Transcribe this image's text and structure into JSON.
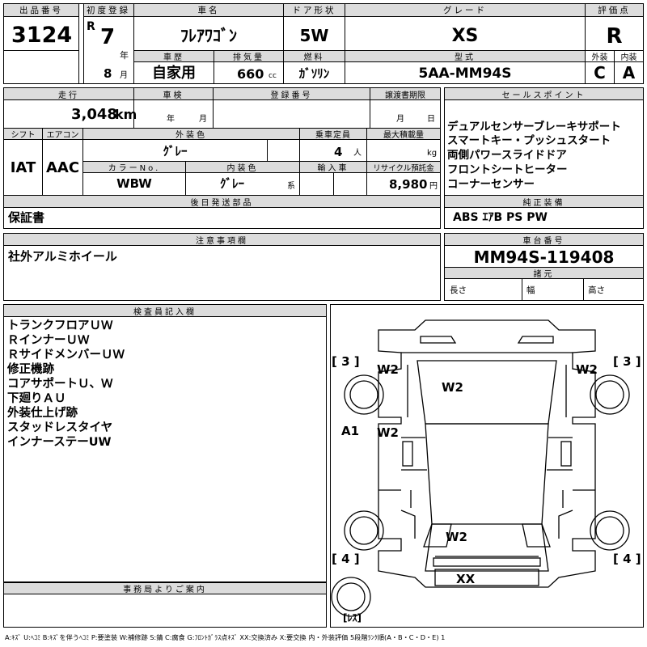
{
  "top": {
    "lot_no_label": "出品番号",
    "lot_no": "3124",
    "first_reg_label": "初度登録",
    "era": "R",
    "year": "7",
    "year_unit": "年",
    "month": "8",
    "month_unit": "月",
    "name_label": "車名",
    "name": "ﾌﾚｱﾜｺﾞﾝ",
    "door_label": "ドア形状",
    "door": "5W",
    "grade_label": "グレード",
    "grade": "XS",
    "score_label": "評価点",
    "score": "R",
    "history_label": "車歴",
    "history": "自家用",
    "cc_label": "排気量",
    "cc": "660",
    "cc_unit": "cc",
    "fuel_label": "燃料",
    "fuel": "ｶﾞｿﾘﾝ",
    "model_label": "型式",
    "model": "5AA-MM94S",
    "ext_label": "外装",
    "ext": "C",
    "int_label": "内装",
    "int": "A"
  },
  "mid": {
    "mileage_label": "走行",
    "mileage": "3,048",
    "mileage_unit": "km",
    "inspect_label": "車検",
    "inspect_year": "年",
    "inspect_month": "月",
    "reg_label": "登録番号",
    "transfer_label": "譲渡書期限",
    "transfer_month": "月",
    "transfer_day": "日",
    "shift_label": "シフト",
    "shift": "IAT",
    "ac_label": "エアコン",
    "ac": "AAC",
    "color_label": "外装色",
    "color": "ｸﾞﾚｰ",
    "cap_label": "乗車定員",
    "cap": "4",
    "cap_unit": "人",
    "load_label": "最大積載量",
    "load_unit": "kg",
    "color_no_label": "カラーNo.",
    "color_no": "WBW",
    "int_color_label": "内装色",
    "int_color": "ｸﾞﾚｰ",
    "int_color_unit": "系",
    "import_label": "輸入車",
    "recycle_label": "リサイクル預託金",
    "recycle": "8,980",
    "recycle_unit": "円",
    "later_label": "後日発送部品",
    "later": "保証書",
    "sales_label": "セールスポイント",
    "sales": [
      "デュアルセンサーブレーキサポート",
      "スマートキー・プッシュスタート",
      "両側パワースライドドア",
      "フロントシートヒーター",
      "コーナーセンサー"
    ],
    "equip_label": "純正装備",
    "equip": "ABS ｴｱB PS PW"
  },
  "notes": {
    "caution_label": "注意事項欄",
    "caution": "社外アルミホイール",
    "chassis_label": "車台番号",
    "chassis": "MM94S-119408",
    "spec_label": "諸元",
    "len": "長さ",
    "wid": "幅",
    "hei": "高さ"
  },
  "inspector": {
    "label": "検査員記入欄",
    "lines": [
      "トランクフロアＵＷ",
      "ＲインナーＵＷ",
      "ＲサイドメンバーＵＷ",
      "修正機跡",
      "コアサポートＵ、Ｗ",
      "下廻りＡＵ",
      "外装仕上げ跡",
      "スタッドレスタイヤ",
      "インナーステーUW"
    ]
  },
  "office": {
    "label": "事務局よりご案内"
  },
  "diagram": {
    "tl": "[ 3 ]",
    "tr": "[ 3 ]",
    "bl": "[ 4 ]",
    "br": "[ 4 ]",
    "w2_lf": "W2",
    "w2_hood": "W2",
    "w2_rf": "W2",
    "w2_door": "W2",
    "w2_trunk": "W2",
    "a1": "A1",
    "xx": "XX",
    "less": "[ﾚｽ]"
  },
  "legend": "A:ｷｽﾞ U:ﾍｺﾐ B:ｷｽﾞを伴うﾍｺﾐ P:要塗装 W:補修跡 S:錆 C:腐食 G:ﾌﾛﾝﾄｶﾞﾗｽ点ｷｽﾞ XX:交換済み X:要交換 内・外装評価 5段階ﾗﾝｸ順(A・B・C・D・E) 1"
}
